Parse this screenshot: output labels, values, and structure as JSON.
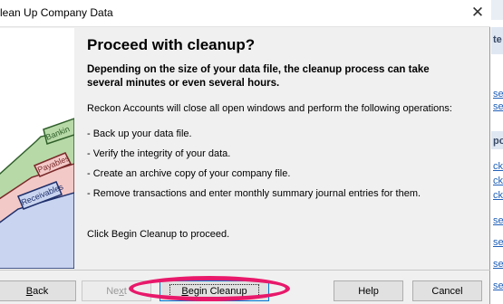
{
  "dialog": {
    "title": "lean Up Company Data",
    "heading": "Proceed with cleanup?",
    "subheading": "Depending on the size of your data file, the cleanup process can take several minutes or even several hours.",
    "intro": "Reckon Accounts will close all open windows and perform the following operations:",
    "operations": [
      "- Back up your data file.",
      "- Verify the integrity of your data.",
      "- Create an archive copy of your company file.",
      "- Remove transactions and enter monthly summary journal entries for them."
    ],
    "footer_note": "Click Begin Cleanup to proceed."
  },
  "folder_illustration": {
    "tabs": [
      "Bankin",
      "Payables",
      "Receivables"
    ],
    "colors": {
      "bank": "#b7d9a8",
      "payables": "#f3c9c7",
      "receivables": "#c9d4f0"
    }
  },
  "buttons": {
    "back": {
      "pre": "",
      "ul": "B",
      "post": "ack"
    },
    "next": {
      "pre": "Ne",
      "ul": "x",
      "post": "t"
    },
    "begin": {
      "pre": "",
      "ul": "B",
      "post": "egin Cleanup"
    },
    "help": "Help",
    "cancel": "Cancel"
  },
  "background_window": {
    "fragments": [
      "te",
      "se",
      "se",
      "po",
      "ck",
      "ck",
      "ck",
      "se",
      "se",
      "se",
      "se"
    ]
  },
  "colors": {
    "highlight": "#e8196a",
    "link": "#1f5fb8"
  }
}
